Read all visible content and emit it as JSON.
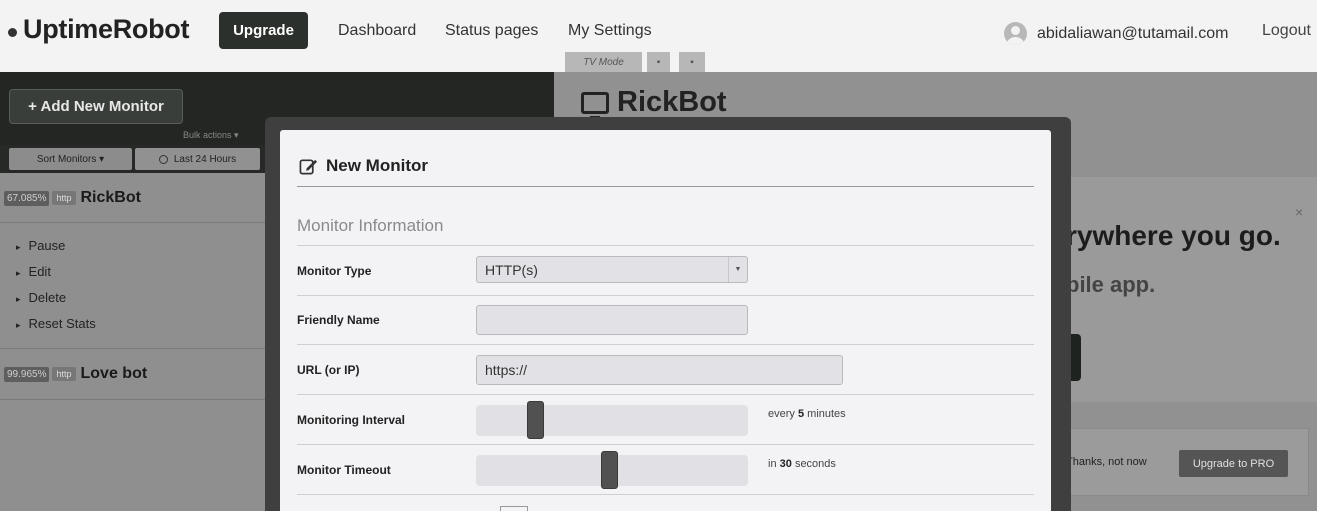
{
  "header": {
    "logo": "UptimeRobot",
    "upgrade_label": "Upgrade",
    "nav": [
      "Dashboard",
      "Status pages",
      "My Settings"
    ],
    "user_email": "abidaliawan@tutamail.com",
    "logout_label": "Logout"
  },
  "sidebar": {
    "add_monitor_label": "+ Add New Monitor",
    "bulk_link": "Bulk actions ▾",
    "sort_label": "Sort Monitors ▾",
    "range_label": "Last 24 Hours",
    "monitors": [
      {
        "uptime": "67.085%",
        "type": "http",
        "name": "RickBot",
        "actions": [
          "Pause",
          "Edit",
          "Delete",
          "Reset Stats"
        ]
      },
      {
        "uptime": "99.965%",
        "type": "http",
        "name": "Love bot"
      }
    ]
  },
  "detail": {
    "tv_mode_label": "TV Mode",
    "monitor_title": "RickBot"
  },
  "promo": {
    "line1": "rywhere you go.",
    "line2": "bile app.",
    "close": "×",
    "thanks_label": "Thanks, not now",
    "pro_label": "Upgrade to PRO"
  },
  "modal": {
    "title": "New Monitor",
    "section": "Monitor Information",
    "fields": {
      "type_label": "Monitor Type",
      "type_value": "HTTP(s)",
      "name_label": "Friendly Name",
      "name_value": "",
      "url_label": "URL (or IP)",
      "url_value": "https://",
      "interval_label": "Monitoring Interval",
      "interval_prefix": "every",
      "interval_value": "5",
      "interval_unit": "minutes",
      "interval_level": 0.2,
      "timeout_label": "Monitor Timeout",
      "timeout_prefix": "in",
      "timeout_value": "30",
      "timeout_unit": "seconds",
      "timeout_level": 0.49
    }
  }
}
